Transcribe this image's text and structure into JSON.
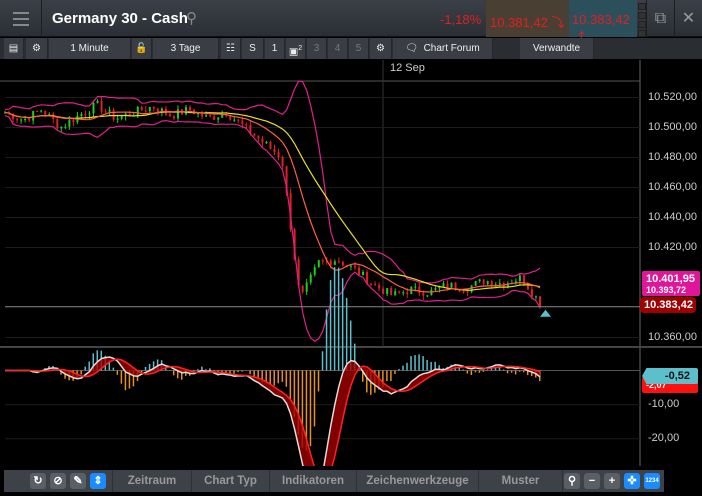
{
  "header": {
    "title": "Germany 30 - Cash",
    "change": "-1,18%",
    "bid": "10.381,42",
    "ask": "10.383,42",
    "bid_arrow": "arrow-down",
    "ask_arrow": "arrow-up"
  },
  "toolbar": {
    "interval": "1 Minute",
    "range": "3 Tage",
    "s_label": "S",
    "one": "1",
    "two_sup": "2",
    "three": "3",
    "four": "4",
    "five": "5",
    "forum": "Chart Forum",
    "related": "Verwandte"
  },
  "chart_data": {
    "type": "candlestick",
    "date_marker": "12 Sep",
    "price_axis": {
      "ticks": [
        "10.520,00",
        "10.500,00",
        "10.480,00",
        "10.460,00",
        "10.440,00",
        "10.420,00",
        "10.360,00"
      ],
      "range": [
        10355,
        10545
      ]
    },
    "price_tags": {
      "upper_band": "10.401,95",
      "ma": "10.393,72",
      "last": "10.383,42"
    },
    "close_anchors": [
      10510,
      10505,
      10512,
      10500,
      10508,
      10515,
      10506,
      10510,
      10514,
      10508,
      10512,
      10506,
      10510,
      10500,
      10490,
      10480,
      10385,
      10410,
      10412,
      10405,
      10395,
      10388,
      10392,
      10390,
      10395,
      10393,
      10398,
      10396,
      10400,
      10383
    ],
    "indicator_axis": {
      "ticks": [
        "-10,00",
        "-20,00"
      ],
      "range": [
        -28,
        6
      ]
    },
    "indicator_tags": {
      "macd": "-0,52",
      "signal": "-2,07"
    }
  },
  "bottom": {
    "zeitraum": "Zeitraum",
    "charttyp": "Chart Typ",
    "indikatoren": "Indikatoren",
    "zeichen": "Zeichenwerkzeuge",
    "muster": "Muster"
  },
  "colors": {
    "up": "#22cc22",
    "down": "#e02020",
    "bands": "#e0208a",
    "ma_slow": "#e8e020",
    "ma_fast": "#ff6040",
    "tag_pink": "#e0169a",
    "tag_red": "#a00000",
    "tag_cyan": "#5bbfcc"
  }
}
